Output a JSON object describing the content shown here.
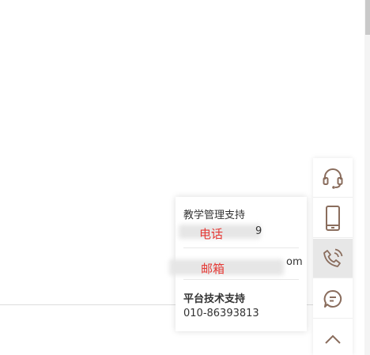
{
  "contact_popup": {
    "teaching_support": {
      "title": "教学管理支持",
      "phone_label": "电话",
      "phone_tail": "9",
      "email_label": "邮箱",
      "email_tail": "om"
    },
    "tech_support": {
      "title": "平台技术支持",
      "phone": "010-86393813"
    }
  },
  "toolbar": {
    "buttons": [
      {
        "icon": "headset-icon",
        "active": false
      },
      {
        "icon": "mobile-phone-icon",
        "active": false
      },
      {
        "icon": "phone-call-icon",
        "active": true
      },
      {
        "icon": "chat-bubble-icon",
        "active": false
      },
      {
        "icon": "chevron-up-icon",
        "active": false
      }
    ]
  },
  "colors": {
    "icon": "#8a6d5d",
    "accent_red": "#e53935",
    "active_bg": "#e7e7e7"
  }
}
